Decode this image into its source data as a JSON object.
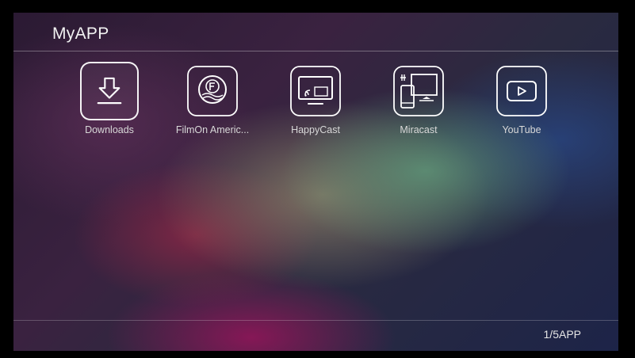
{
  "header": {
    "title": "MyAPP"
  },
  "apps": [
    {
      "label": "Downloads",
      "icon": "download-icon",
      "focused": true
    },
    {
      "label": "FilmOn Americ...",
      "icon": "filmon-icon",
      "focused": false
    },
    {
      "label": "HappyCast",
      "icon": "cast-icon",
      "focused": false
    },
    {
      "label": "Miracast",
      "icon": "miracast-icon",
      "focused": false
    },
    {
      "label": "YouTube",
      "icon": "youtube-icon",
      "focused": false
    }
  ],
  "footer": {
    "page_indicator": "1/5APP"
  },
  "colors": {
    "icon_stroke": "#ffffff",
    "text": "#d8d8d8"
  }
}
